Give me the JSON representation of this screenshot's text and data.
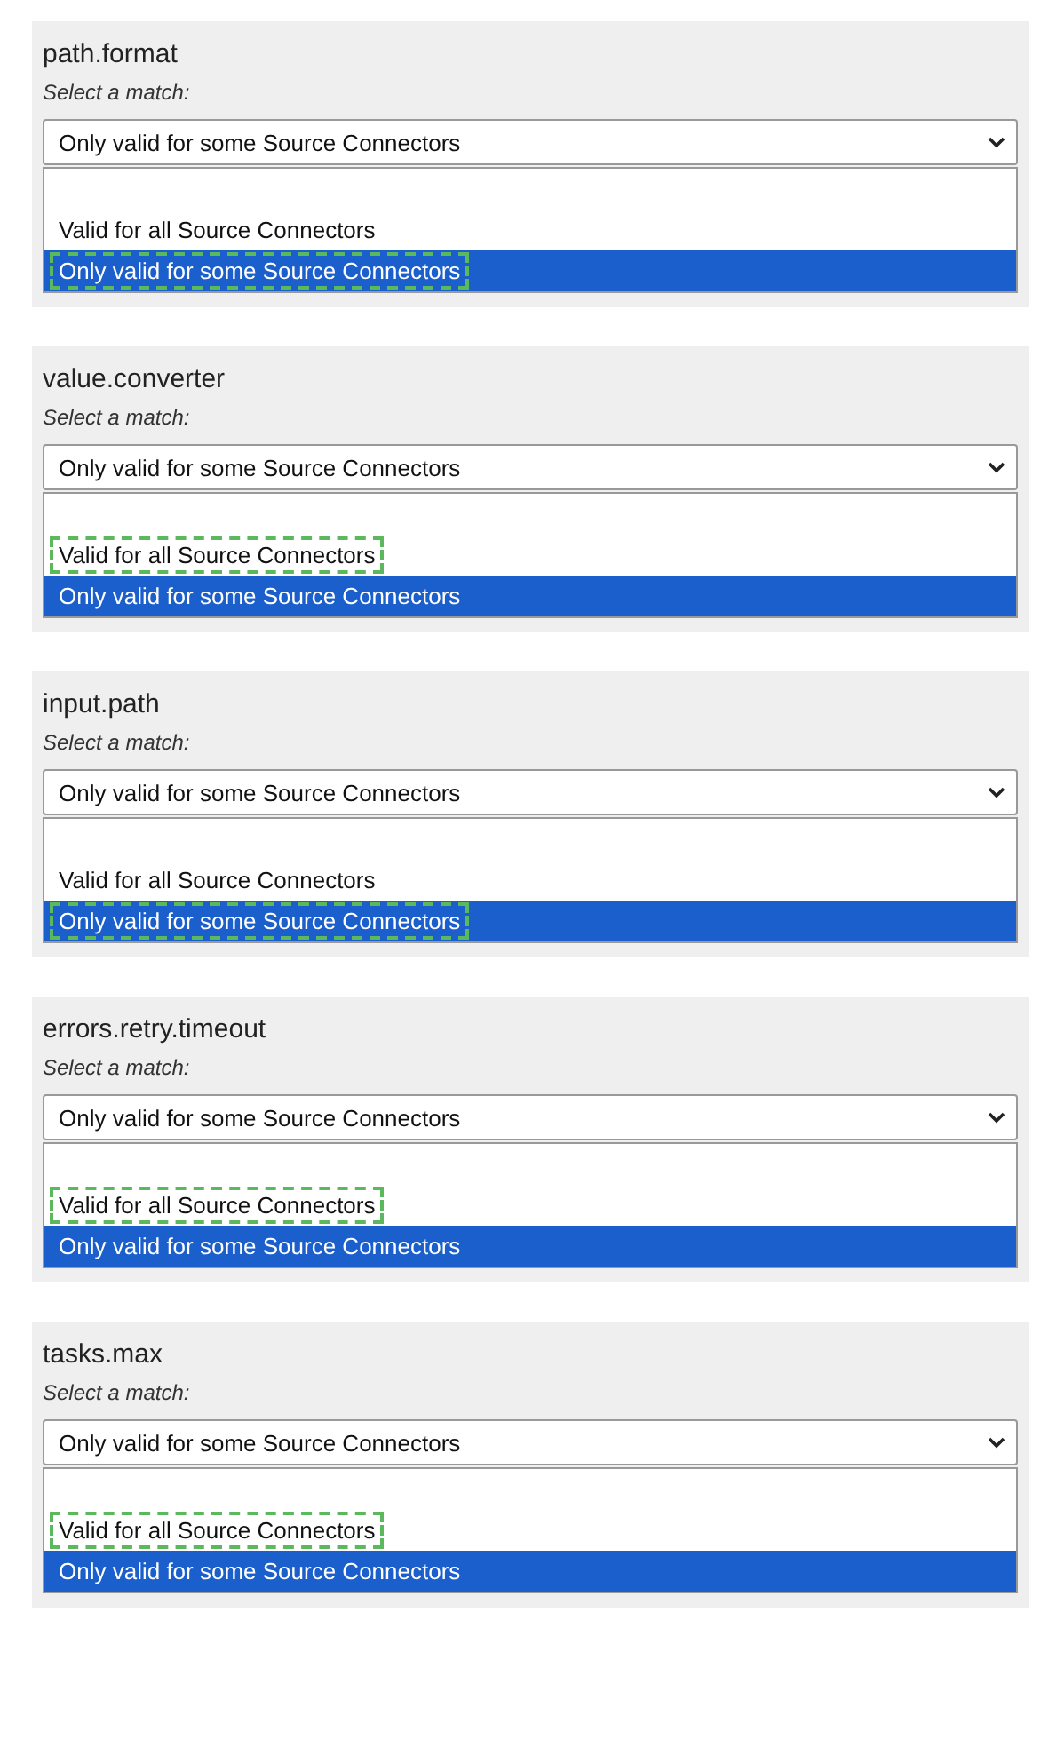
{
  "panels": [
    {
      "title": "path.format",
      "prompt": "Select a match:",
      "select_value": "Only valid for some Source Connectors",
      "options": [
        {
          "label": "Valid for all Source Connectors",
          "selected": false,
          "marked": false
        },
        {
          "label": "Only valid for some Source Connectors",
          "selected": true,
          "marked": true
        }
      ]
    },
    {
      "title": "value.converter",
      "prompt": "Select a match:",
      "select_value": "Only valid for some Source Connectors",
      "options": [
        {
          "label": "Valid for all Source Connectors",
          "selected": false,
          "marked": true
        },
        {
          "label": "Only valid for some Source Connectors",
          "selected": true,
          "marked": false
        }
      ]
    },
    {
      "title": "input.path",
      "prompt": "Select a match:",
      "select_value": "Only valid for some Source Connectors",
      "options": [
        {
          "label": "Valid for all Source Connectors",
          "selected": false,
          "marked": false
        },
        {
          "label": "Only valid for some Source Connectors",
          "selected": true,
          "marked": true
        }
      ]
    },
    {
      "title": "errors.retry.timeout",
      "prompt": "Select a match:",
      "select_value": "Only valid for some Source Connectors",
      "options": [
        {
          "label": "Valid for all Source Connectors",
          "selected": false,
          "marked": true
        },
        {
          "label": "Only valid for some Source Connectors",
          "selected": true,
          "marked": false
        }
      ]
    },
    {
      "title": "tasks.max",
      "prompt": "Select a match:",
      "select_value": "Only valid for some Source Connectors",
      "options": [
        {
          "label": "Valid for all Source Connectors",
          "selected": false,
          "marked": true
        },
        {
          "label": "Only valid for some Source Connectors",
          "selected": true,
          "marked": false
        }
      ]
    }
  ]
}
